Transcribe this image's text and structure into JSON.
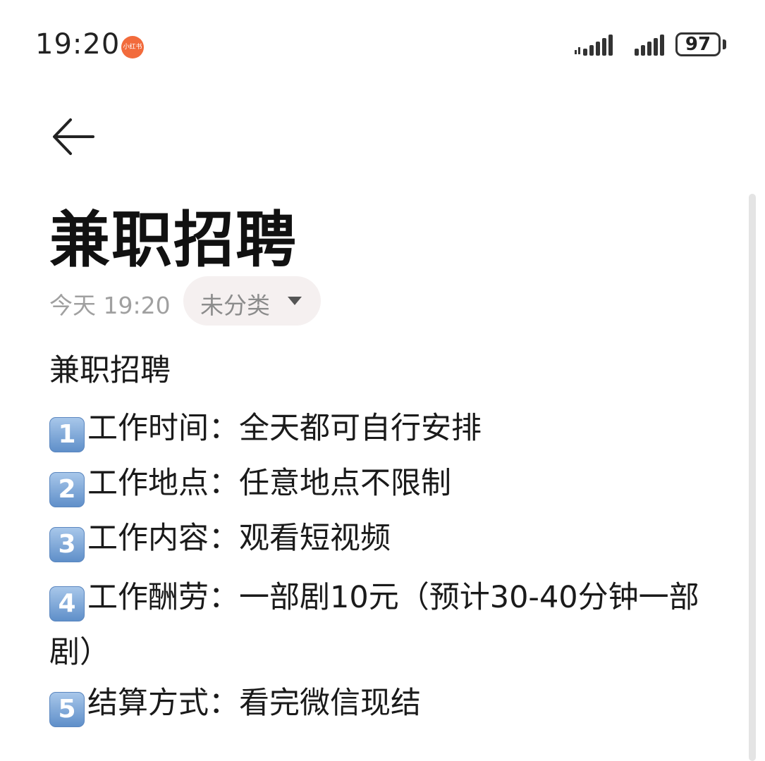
{
  "status_bar": {
    "time": "19:20",
    "app_badge": "小红书",
    "battery": "97"
  },
  "note": {
    "title": "兼职招聘",
    "date": "今天 19:20",
    "category": "未分类",
    "body": {
      "heading": "兼职招聘",
      "items": [
        {
          "num": "1",
          "text": "工作时间：全天都可自行安排"
        },
        {
          "num": "2",
          "text": "工作地点：任意地点不限制"
        },
        {
          "num": "3",
          "text": "工作内容：观看短视频"
        },
        {
          "num": "4",
          "text": "工作酬劳：一部剧10元（预计30-40分钟一部剧）"
        },
        {
          "num": "5",
          "text": "结算方式：看完微信现结"
        }
      ]
    }
  },
  "icons": [
    "back-arrow-icon",
    "dropdown-caret-icon",
    "signal-icon",
    "battery-icon"
  ]
}
